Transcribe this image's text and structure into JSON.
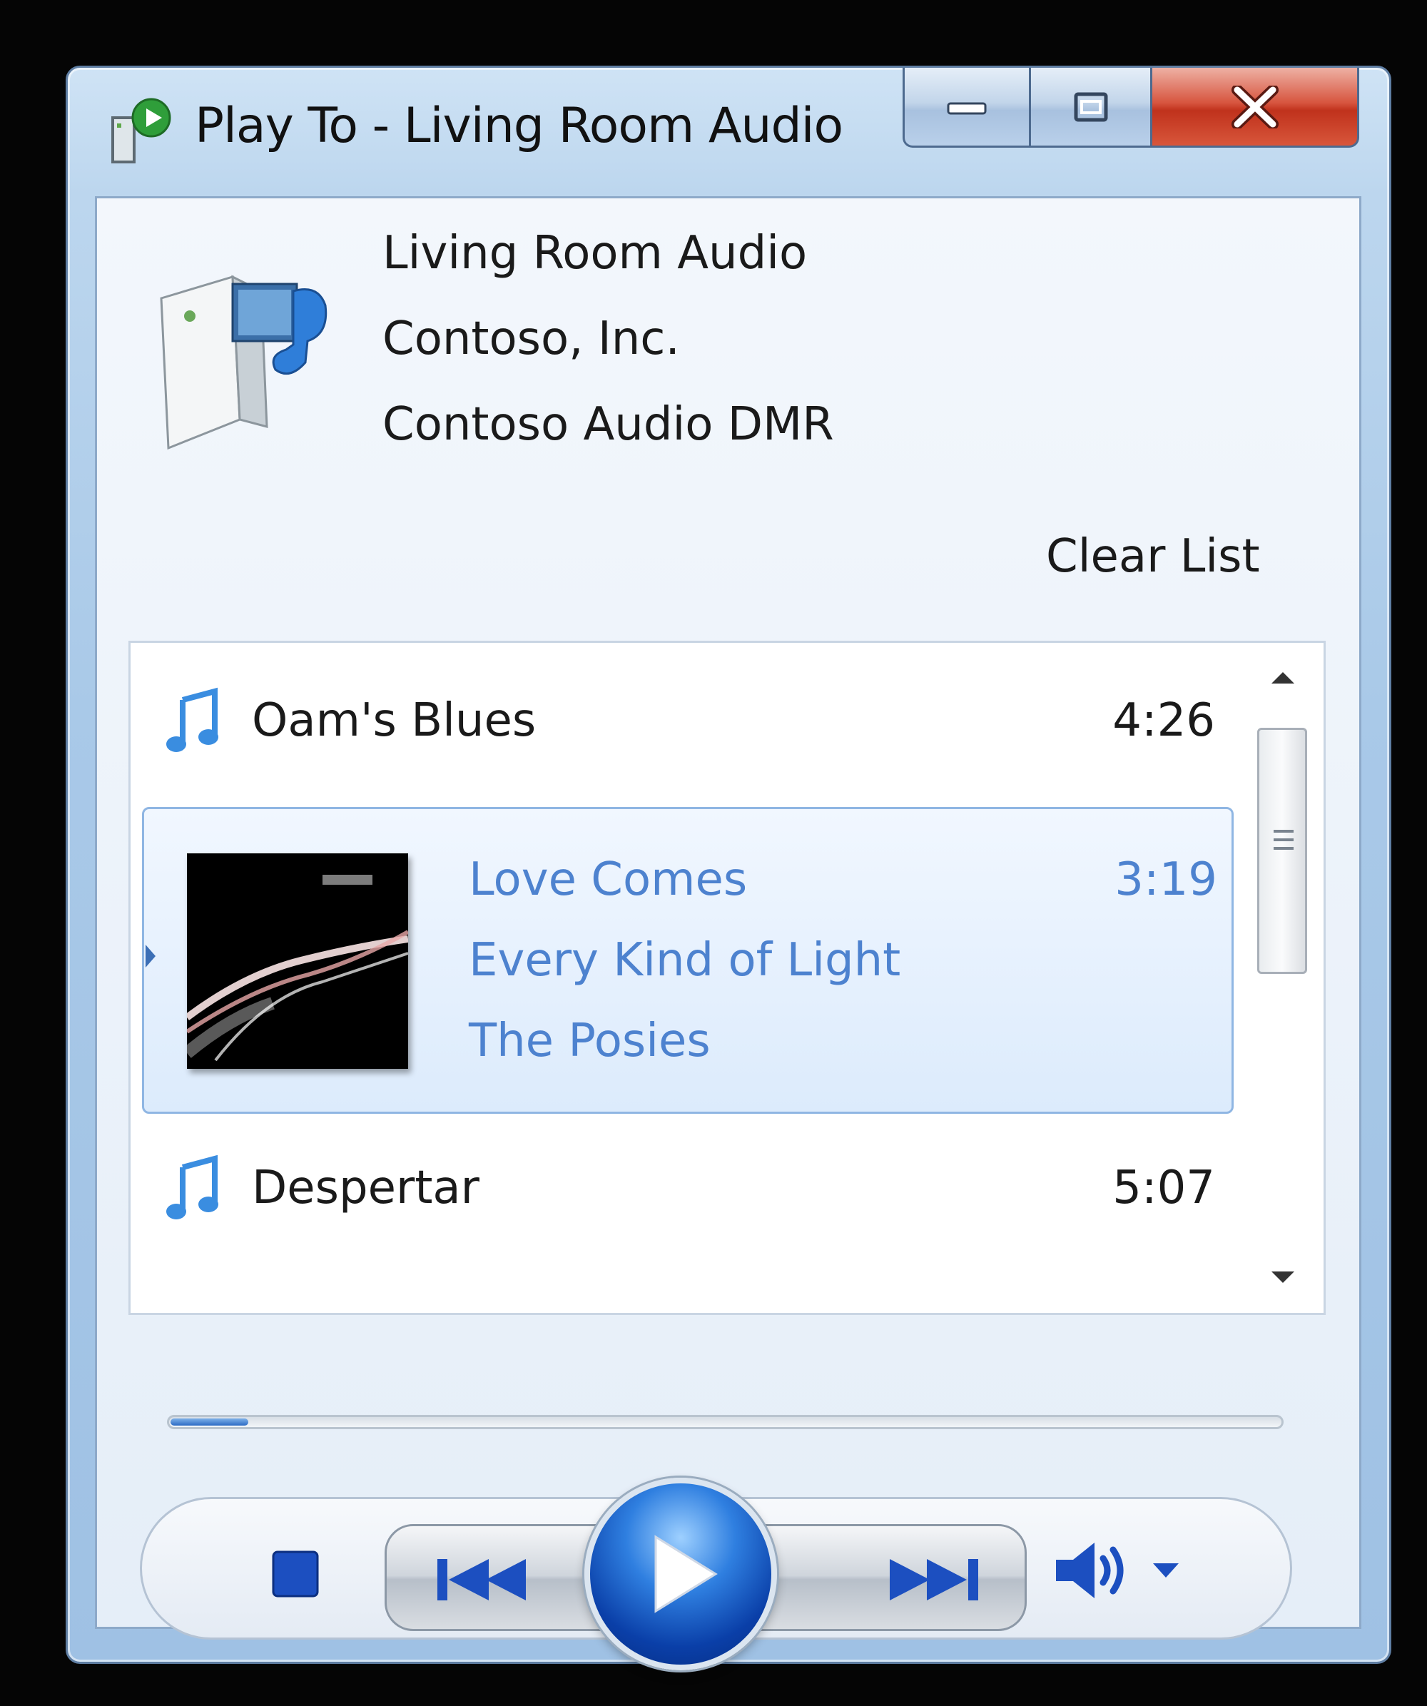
{
  "window": {
    "title": "Play To - Living Room Audio"
  },
  "device": {
    "name": "Living Room Audio",
    "manufacturer": "Contoso, Inc.",
    "model": "Contoso Audio DMR"
  },
  "actions": {
    "clear_list": "Clear List"
  },
  "playlist": {
    "items": [
      {
        "title": "Oam's Blues",
        "duration": "4:26"
      },
      {
        "title": "Love Comes",
        "album": "Every Kind of Light",
        "artist": "The Posies",
        "duration": "3:19",
        "selected": true
      },
      {
        "title": "Despertar",
        "duration": "5:07"
      }
    ]
  },
  "playback": {
    "progress_fraction": 0.07
  },
  "icons": {
    "app": "play-to-icon",
    "device": "media-renderer-device-icon",
    "note": "music-note-icon",
    "stop": "stop-icon",
    "previous": "previous-track-icon",
    "play": "play-icon",
    "next": "next-track-icon",
    "volume": "speaker-volume-icon",
    "dropdown": "chevron-down-icon"
  },
  "colors": {
    "accent_blue": "#2c6ac4",
    "selected_text": "#4d82cf",
    "close_red": "#c0321c"
  }
}
